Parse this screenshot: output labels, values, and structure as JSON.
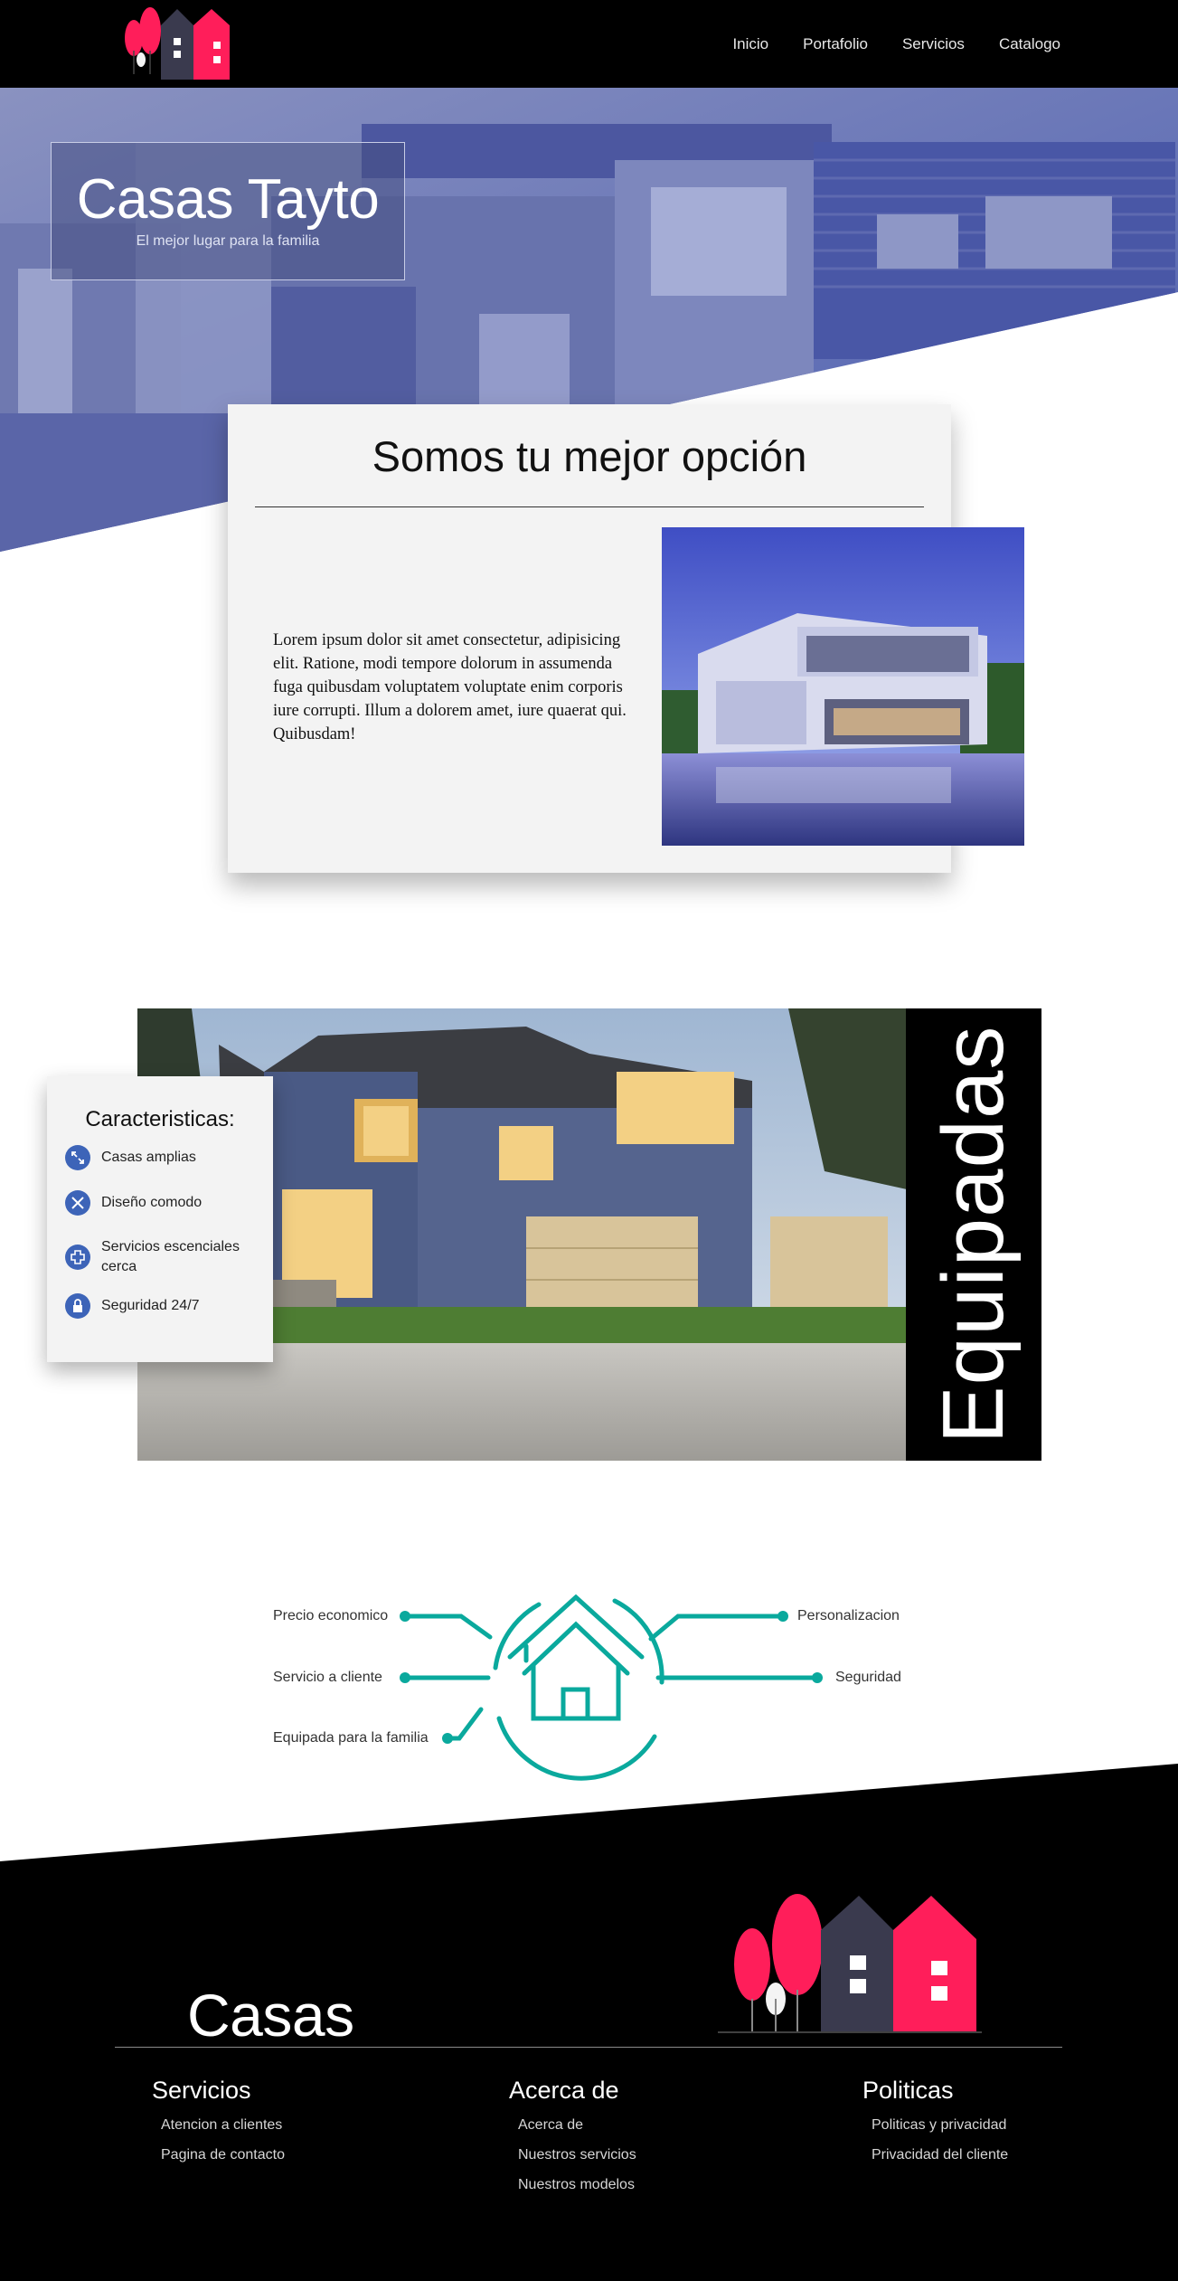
{
  "nav": {
    "links": [
      "Inicio",
      "Portafolio",
      "Servicios",
      "Catalogo"
    ]
  },
  "hero": {
    "title": "Casas Tayto",
    "subtitle": "El mejor lugar para la familia"
  },
  "intro": {
    "heading": "Somos tu mejor opción",
    "text": "Lorem ipsum dolor sit amet consectetur, adipisicing elit. Ratione, modi tempore dolorum in assumenda fuga quibusdam voluptatem voluptate enim corporis iure corrupti. Illum a dolorem amet, iure quaerat qui. Quibusdam!"
  },
  "features": {
    "title": "Caracteristicas:",
    "items": [
      {
        "label": "Casas amplias",
        "icon": "expand-icon"
      },
      {
        "label": "Diseño comodo",
        "icon": "tools-icon"
      },
      {
        "label": "Servicios escenciales cerca",
        "icon": "medical-cross-icon"
      },
      {
        "label": "Seguridad 24/7",
        "icon": "security-lock-icon"
      }
    ],
    "banner_word": "Equipadas"
  },
  "diagram": {
    "left": [
      "Precio economico",
      "Servicio a cliente",
      "Equipada para la familia"
    ],
    "right": [
      "Personalizacion",
      "Seguridad"
    ],
    "icon": "house-icon"
  },
  "footer": {
    "brand": "Casas",
    "columns": [
      {
        "title": "Servicios",
        "links": [
          "Atencion a clientes",
          "Pagina de contacto"
        ]
      },
      {
        "title": "Acerca de",
        "links": [
          "Acerca de",
          "Nuestros servicios",
          "Nuestros modelos"
        ]
      },
      {
        "title": "Politicas",
        "links": [
          "Politicas y privacidad",
          "Privacidad del cliente"
        ]
      }
    ]
  },
  "colors": {
    "accent_pink": "#ff1e5a",
    "dark_house": "#3a3a4e",
    "teal": "#0aa99d",
    "icon_blue": "#3d64b8"
  }
}
